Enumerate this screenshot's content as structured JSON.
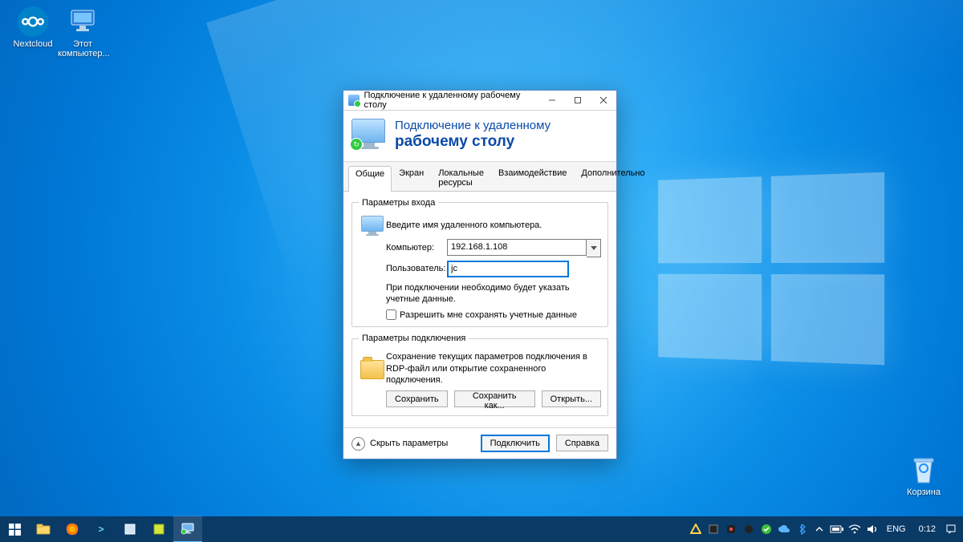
{
  "desktop_icons": {
    "nextcloud": "Nextcloud",
    "this_pc": "Этот компьютер...",
    "recycle_bin": "Корзина"
  },
  "dialog": {
    "window_title": "Подключение к удаленному рабочему столу",
    "banner_line1": "Подключение к удаленному",
    "banner_line2": "рабочему столу",
    "tabs": {
      "general": "Общие",
      "display": "Экран",
      "local": "Локальные ресурсы",
      "experience": "Взаимодействие",
      "advanced": "Дополнительно"
    },
    "login_group": {
      "legend": "Параметры входа",
      "instruction": "Введите имя удаленного компьютера.",
      "computer_label": "Компьютер:",
      "computer_value": "192.168.1.108",
      "user_label": "Пользователь:",
      "user_value": "jc",
      "credentials_note": "При подключении необходимо будет указать учетные данные.",
      "remember_checkbox": "Разрешить мне сохранять учетные данные"
    },
    "connection_group": {
      "legend": "Параметры подключения",
      "description": "Сохранение текущих параметров подключения в RDP-файл или открытие сохраненного подключения.",
      "save_btn": "Сохранить",
      "save_as_btn": "Сохранить как...",
      "open_btn": "Открыть..."
    },
    "footer": {
      "hide_options": "Скрыть параметры",
      "connect_btn": "Подключить",
      "help_btn": "Справка"
    }
  },
  "taskbar": {
    "lang": "ENG",
    "time": "0:12"
  }
}
